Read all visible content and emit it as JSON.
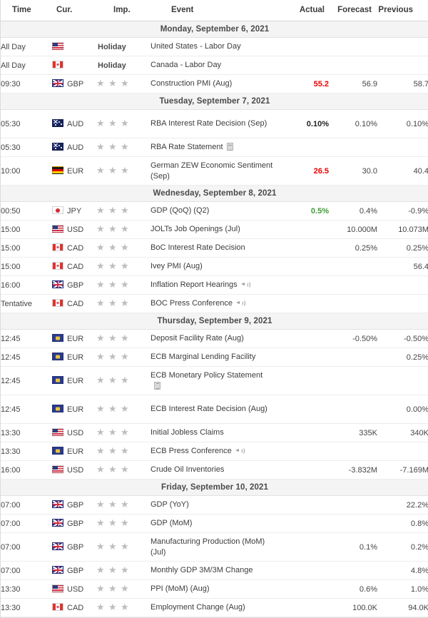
{
  "table": {
    "columns": [
      {
        "key": "time",
        "label": "Time"
      },
      {
        "key": "cur",
        "label": "Cur."
      },
      {
        "key": "imp",
        "label": "Imp."
      },
      {
        "key": "event",
        "label": "Event"
      },
      {
        "key": "actual",
        "label": "Actual"
      },
      {
        "key": "forecast",
        "label": "Forecast"
      },
      {
        "key": "previous",
        "label": "Previous"
      }
    ]
  },
  "colors": {
    "actual_worse": "#ec0000",
    "actual_better": "#3f9c35",
    "actual_neutral": "#222222",
    "day_band_bg": "#f4f4f4",
    "row_border": "#ededed",
    "star_grey": "#bdbdbd"
  },
  "days": [
    {
      "header": "Monday, September 6, 2021",
      "rows": [
        {
          "time": "All Day",
          "currency": "",
          "flag": "us",
          "importance": 0,
          "holiday": "Holiday",
          "event": "United States - Labor Day",
          "icon": "",
          "actual": "",
          "forecast": "",
          "previous": "",
          "actual_state": "none",
          "lines": 1
        },
        {
          "time": "All Day",
          "currency": "",
          "flag": "ca",
          "importance": 0,
          "holiday": "Holiday",
          "event": "Canada - Labor Day",
          "icon": "",
          "actual": "",
          "forecast": "",
          "previous": "",
          "actual_state": "none",
          "lines": 1
        },
        {
          "time": "09:30",
          "currency": "GBP",
          "flag": "gb",
          "importance": 3,
          "holiday": "",
          "event": "Construction PMI (Aug)",
          "icon": "",
          "actual": "55.2",
          "forecast": "56.9",
          "previous": "58.7",
          "actual_state": "worse",
          "lines": 1
        }
      ]
    },
    {
      "header": "Tuesday, September 7, 2021",
      "rows": [
        {
          "time": "05:30",
          "currency": "AUD",
          "flag": "au",
          "importance": 3,
          "holiday": "",
          "event": "RBA Interest Rate Decision (Sep)",
          "icon": "",
          "actual": "0.10%",
          "forecast": "0.10%",
          "previous": "0.10%",
          "actual_state": "neutral",
          "lines": 2
        },
        {
          "time": "05:30",
          "currency": "AUD",
          "flag": "au",
          "importance": 3,
          "holiday": "",
          "event": "RBA Rate Statement",
          "icon": "document",
          "actual": "",
          "forecast": "",
          "previous": "",
          "actual_state": "none",
          "lines": 1
        },
        {
          "time": "10:00",
          "currency": "EUR",
          "flag": "de",
          "importance": 3,
          "holiday": "",
          "event": "German ZEW Economic Sentiment (Sep)",
          "icon": "",
          "actual": "26.5",
          "forecast": "30.0",
          "previous": "40.4",
          "actual_state": "worse",
          "lines": 2
        }
      ]
    },
    {
      "header": "Wednesday, September 8, 2021",
      "rows": [
        {
          "time": "00:50",
          "currency": "JPY",
          "flag": "jp",
          "importance": 3,
          "holiday": "",
          "event": "GDP (QoQ) (Q2)",
          "icon": "",
          "actual": "0.5%",
          "forecast": "0.4%",
          "previous": "-0.9%",
          "actual_state": "better",
          "lines": 1
        },
        {
          "time": "15:00",
          "currency": "USD",
          "flag": "us",
          "importance": 3,
          "holiday": "",
          "event": "JOLTs Job Openings (Jul)",
          "icon": "",
          "actual": "",
          "forecast": "10.000M",
          "previous": "10.073M",
          "actual_state": "none",
          "lines": 1
        },
        {
          "time": "15:00",
          "currency": "CAD",
          "flag": "ca",
          "importance": 3,
          "holiday": "",
          "event": "BoC Interest Rate Decision",
          "icon": "",
          "actual": "",
          "forecast": "0.25%",
          "previous": "0.25%",
          "actual_state": "none",
          "lines": 1
        },
        {
          "time": "15:00",
          "currency": "CAD",
          "flag": "ca",
          "importance": 3,
          "holiday": "",
          "event": "Ivey PMI (Aug)",
          "icon": "",
          "actual": "",
          "forecast": "",
          "previous": "56.4",
          "actual_state": "none",
          "lines": 1
        },
        {
          "time": "16:00",
          "currency": "GBP",
          "flag": "gb",
          "importance": 3,
          "holiday": "",
          "event": "Inflation Report Hearings",
          "icon": "speaker",
          "actual": "",
          "forecast": "",
          "previous": "",
          "actual_state": "none",
          "lines": 1
        },
        {
          "time": "Tentative",
          "currency": "CAD",
          "flag": "ca",
          "importance": 3,
          "holiday": "",
          "event": "BOC Press Conference",
          "icon": "speaker",
          "actual": "",
          "forecast": "",
          "previous": "",
          "actual_state": "none",
          "lines": 1
        }
      ]
    },
    {
      "header": "Thursday, September 9, 2021",
      "rows": [
        {
          "time": "12:45",
          "currency": "EUR",
          "flag": "eu",
          "importance": 3,
          "holiday": "",
          "event": "Deposit Facility Rate (Aug)",
          "icon": "",
          "actual": "",
          "forecast": "-0.50%",
          "previous": "-0.50%",
          "actual_state": "none",
          "lines": 1
        },
        {
          "time": "12:45",
          "currency": "EUR",
          "flag": "eu",
          "importance": 3,
          "holiday": "",
          "event": "ECB Marginal Lending Facility",
          "icon": "",
          "actual": "",
          "forecast": "",
          "previous": "0.25%",
          "actual_state": "none",
          "lines": 1
        },
        {
          "time": "12:45",
          "currency": "EUR",
          "flag": "eu",
          "importance": 3,
          "holiday": "",
          "event": "ECB Monetary Policy Statement",
          "icon": "document-below",
          "actual": "",
          "forecast": "",
          "previous": "",
          "actual_state": "none",
          "lines": 2
        },
        {
          "time": "12:45",
          "currency": "EUR",
          "flag": "eu",
          "importance": 3,
          "holiday": "",
          "event": "ECB Interest Rate Decision (Aug)",
          "icon": "",
          "actual": "",
          "forecast": "",
          "previous": "0.00%",
          "actual_state": "none",
          "lines": 2
        },
        {
          "time": "13:30",
          "currency": "USD",
          "flag": "us",
          "importance": 3,
          "holiday": "",
          "event": "Initial Jobless Claims",
          "icon": "",
          "actual": "",
          "forecast": "335K",
          "previous": "340K",
          "actual_state": "none",
          "lines": 1
        },
        {
          "time": "13:30",
          "currency": "EUR",
          "flag": "eu",
          "importance": 3,
          "holiday": "",
          "event": "ECB Press Conference",
          "icon": "speaker",
          "actual": "",
          "forecast": "",
          "previous": "",
          "actual_state": "none",
          "lines": 1
        },
        {
          "time": "16:00",
          "currency": "USD",
          "flag": "us",
          "importance": 3,
          "holiday": "",
          "event": "Crude Oil Inventories",
          "icon": "",
          "actual": "",
          "forecast": "-3.832M",
          "previous": "-7.169M",
          "actual_state": "none",
          "lines": 1
        }
      ]
    },
    {
      "header": "Friday, September 10, 2021",
      "rows": [
        {
          "time": "07:00",
          "currency": "GBP",
          "flag": "gb",
          "importance": 3,
          "holiday": "",
          "event": "GDP (YoY)",
          "icon": "",
          "actual": "",
          "forecast": "",
          "previous": "22.2%",
          "actual_state": "none",
          "lines": 1
        },
        {
          "time": "07:00",
          "currency": "GBP",
          "flag": "gb",
          "importance": 3,
          "holiday": "",
          "event": "GDP (MoM)",
          "icon": "",
          "actual": "",
          "forecast": "",
          "previous": "0.8%",
          "actual_state": "none",
          "lines": 1
        },
        {
          "time": "07:00",
          "currency": "GBP",
          "flag": "gb",
          "importance": 3,
          "holiday": "",
          "event": "Manufacturing Production (MoM) (Jul)",
          "icon": "",
          "actual": "",
          "forecast": "0.1%",
          "previous": "0.2%",
          "actual_state": "none",
          "lines": 2
        },
        {
          "time": "07:00",
          "currency": "GBP",
          "flag": "gb",
          "importance": 3,
          "holiday": "",
          "event": "Monthly GDP 3M/3M Change",
          "icon": "",
          "actual": "",
          "forecast": "",
          "previous": "4.8%",
          "actual_state": "none",
          "lines": 1
        },
        {
          "time": "13:30",
          "currency": "USD",
          "flag": "us",
          "importance": 3,
          "holiday": "",
          "event": "PPI (MoM) (Aug)",
          "icon": "",
          "actual": "",
          "forecast": "0.6%",
          "previous": "1.0%",
          "actual_state": "none",
          "lines": 1
        },
        {
          "time": "13:30",
          "currency": "CAD",
          "flag": "ca",
          "importance": 3,
          "holiday": "",
          "event": "Employment Change (Aug)",
          "icon": "",
          "actual": "",
          "forecast": "100.0K",
          "previous": "94.0K",
          "actual_state": "none",
          "lines": 1
        }
      ]
    }
  ]
}
